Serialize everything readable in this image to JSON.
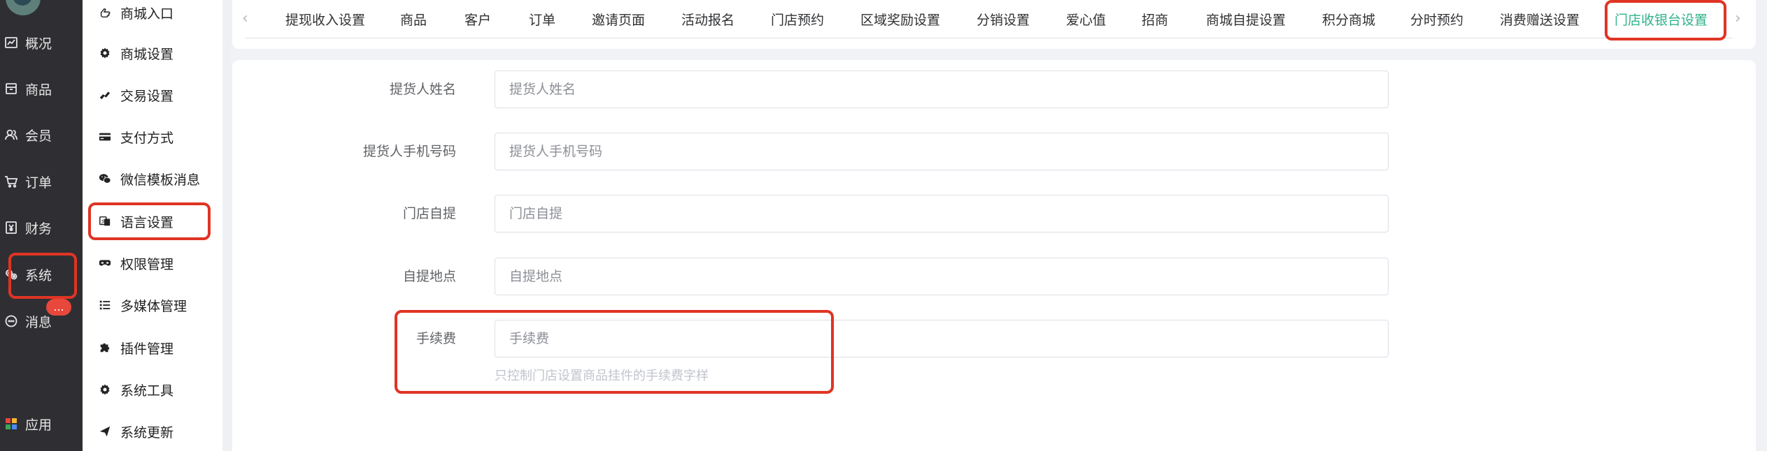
{
  "rail": {
    "items": [
      {
        "label": "概况",
        "icon": "chart-icon"
      },
      {
        "label": "商品",
        "icon": "box-icon"
      },
      {
        "label": "会员",
        "icon": "users-icon"
      },
      {
        "label": "订单",
        "icon": "cart-icon"
      },
      {
        "label": "财务",
        "icon": "yen-doc-icon"
      },
      {
        "label": "系统",
        "icon": "gears-icon"
      },
      {
        "label": "消息",
        "icon": "chat-icon"
      },
      {
        "label": "应用",
        "icon": "apps-icon"
      }
    ],
    "badge": "..."
  },
  "submenu": {
    "items": [
      {
        "label": "商城入口",
        "icon": "pointer-hand-icon"
      },
      {
        "label": "商城设置",
        "icon": "gear-icon"
      },
      {
        "label": "交易设置",
        "icon": "handshake-icon"
      },
      {
        "label": "支付方式",
        "icon": "card-icon"
      },
      {
        "label": "微信模板消息",
        "icon": "wechat-icon"
      },
      {
        "label": "语言设置",
        "icon": "language-icon"
      },
      {
        "label": "权限管理",
        "icon": "mask-icon"
      },
      {
        "label": "多媒体管理",
        "icon": "list-icon"
      },
      {
        "label": "插件管理",
        "icon": "puzzle-icon"
      },
      {
        "label": "系统工具",
        "icon": "gear-icon"
      },
      {
        "label": "系统更新",
        "icon": "send-icon"
      }
    ]
  },
  "tabs": {
    "items": [
      "提现收入设置",
      "商品",
      "客户",
      "订单",
      "邀请页面",
      "活动报名",
      "门店预约",
      "区域奖励设置",
      "分销设置",
      "爱心值",
      "招商",
      "商城自提设置",
      "积分商城",
      "分时预约",
      "消费赠送设置",
      "门店收银台设置"
    ],
    "active": "门店收银台设置",
    "prev": "‹",
    "next": "›"
  },
  "form": {
    "fields": [
      {
        "label": "提货人姓名",
        "placeholder": "提货人姓名",
        "value": ""
      },
      {
        "label": "提货人手机号码",
        "placeholder": "提货人手机号码",
        "value": ""
      },
      {
        "label": "门店自提",
        "placeholder": "门店自提",
        "value": ""
      },
      {
        "label": "自提地点",
        "placeholder": "自提地点",
        "value": ""
      },
      {
        "label": "手续费",
        "placeholder": "手续费",
        "value": ""
      }
    ],
    "fee_hint": "只控制门店设置商品挂件的手续费字样"
  },
  "colors": {
    "rail_bg": "#2f2f33",
    "active_tab": "#2fb38a",
    "highlight": "#e03424",
    "badge": "#e8473c"
  }
}
